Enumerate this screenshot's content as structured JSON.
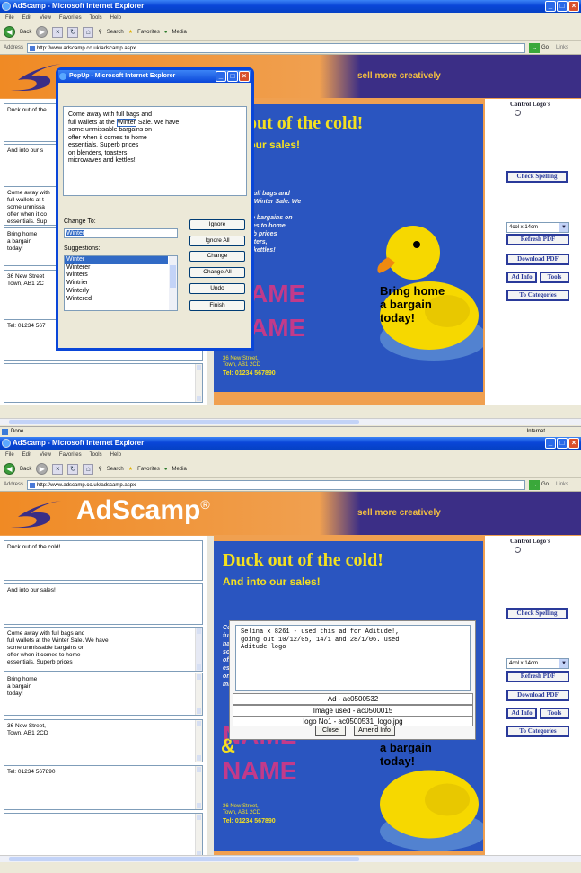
{
  "browser": {
    "window_title": "AdScamp - Microsoft Internet Explorer",
    "menu": [
      "File",
      "Edit",
      "View",
      "Favorites",
      "Tools",
      "Help"
    ],
    "toolbar": {
      "back": "Back",
      "search": "Search",
      "favorites": "Favorites",
      "media": "Media"
    },
    "address_label": "Address",
    "address_top": "http://www.adscamp.co.uk/adscamp.aspx",
    "address_bottom": "http://www.adscamp.co.uk/adscamp.aspx",
    "go_label": "Go",
    "links_label": "Links",
    "status_done": "Done",
    "status_zone": "Internet"
  },
  "site": {
    "logo_text": "AdScamp",
    "logo_mark": "®",
    "tagline": "sell more creatively"
  },
  "left_fields_top": [
    "Duck out of the",
    "And into our s",
    "Come away with\nfull wallets at t\nsome unmissa\noffer when it co\nessentials. Sup",
    "Bring home\na bargain\ntoday!",
    "36 New Street\nTown, AB1 2C",
    "Tel: 01234 567"
  ],
  "left_fields_bottom": [
    "Duck out of the cold!",
    "And into our sales!",
    "Come away with full bags and\nfull wallets at the Winter Sale. We have\nsome unmissable bargains on\noffer when it comes to home\nessentials. Superb prices",
    "Bring home\na bargain\ntoday!",
    "36 New Street,\nTown, AB1 2CD",
    "Tel: 01234 567890"
  ],
  "ad": {
    "headline_top": "out of the cold!",
    "subline_top": "into our sales!",
    "headline": "Duck out of the cold!",
    "subline": "And into our sales!",
    "body_top": "ay with full bags and\nts at the Winter Sale. We\n\nmissable bargains on\nn it comes to home\ns. Superb prices\ners, toasters,\nves and kettles!",
    "body_bottom": "Co\nful\nhav\nso\noff\ness\non\nmic",
    "name_top_1": "AME",
    "name_top_2": "AME",
    "name_1": "NAME",
    "amp": "&",
    "name_2": "NAME",
    "address": "36 New Street,\nTown, AB1 2CD",
    "tel": "Tel: 01234 567890",
    "bring": "Bring home\na bargain\ntoday!",
    "bring_bottom": "a bargain\ntoday!"
  },
  "right_panel": {
    "control_logos": "Control Logo's",
    "check_spelling": "Check Spelling",
    "size_option": "4col x 14cm",
    "refresh_pdf": "Refresh PDF",
    "download_pdf": "Download PDF",
    "ad_info": "Ad Info",
    "tools": "Tools",
    "to_categories": "To Categories"
  },
  "spell_popup": {
    "title": "PopUp - Microsoft Internet Explorer",
    "text_before": "Come away with full bags and\nfull wallets at the ",
    "text_word": "Winter",
    "text_after": " Sale. We have\nsome unmissable bargains on\noffer when it comes to home\nessentials. Superb prices\non blenders, toasters,\nmicrowaves and kettles!",
    "change_to_label": "Change To:",
    "change_to_value": "Winter",
    "suggestions_label": "Suggestions:",
    "suggestions": [
      "Winter",
      "Winterer",
      "Winters",
      "Wintrier",
      "Winterly",
      "Wintered"
    ],
    "buttons": [
      "Ignore",
      "Ignore All",
      "Change",
      "Change All",
      "Undo",
      "Finish"
    ]
  },
  "info_popup": {
    "note": "Selina x 8261 - used this ad for Aditude!,\ngoing out 10/12/05, 14/1 and 28/1/06. used\nAditude logo",
    "ad_id": "Ad - ac0500532",
    "image_used": "Image used - ac0500015",
    "logo": "logo No1 - ac0500531_logo.jpg",
    "close": "Close",
    "amend": "Amend Info"
  },
  "colors": {
    "xp_blue": "#0a46d8",
    "header_orange": "#f08a24",
    "header_purple": "#3b2e86",
    "ad_blue": "#2a55c0",
    "headline_yellow": "#f4e020",
    "name_magenta": "#c23a8a"
  }
}
